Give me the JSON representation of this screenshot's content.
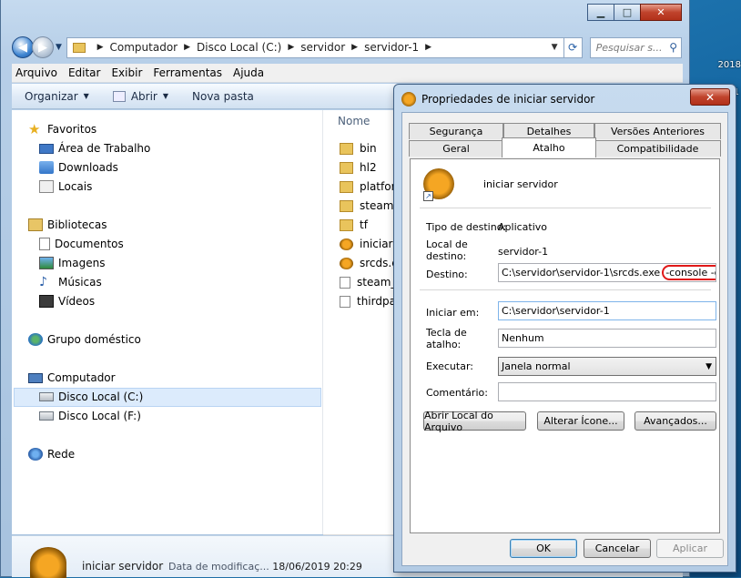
{
  "desktop": {
    "corner_text_1": "2018",
    "corner_text_2": "1"
  },
  "explorer": {
    "caption": {
      "minimize": "▁",
      "maximize": "□",
      "close": "✕"
    },
    "address": {
      "crumbs": [
        "Computador",
        "Disco Local (C:)",
        "servidor",
        "servidor-1"
      ]
    },
    "search_placeholder": "Pesquisar s...",
    "menu": [
      "Arquivo",
      "Editar",
      "Exibir",
      "Ferramentas",
      "Ajuda"
    ],
    "toolbar": {
      "organize": "Organizar",
      "open": "Abrir",
      "new_folder": "Nova pasta"
    },
    "nav": {
      "favorites": "Favoritos",
      "desktop": "Área de Trabalho",
      "downloads": "Downloads",
      "places": "Locais",
      "libraries": "Bibliotecas",
      "documents": "Documentos",
      "images": "Imagens",
      "music": "Músicas",
      "videos": "Vídeos",
      "homegroup": "Grupo doméstico",
      "computer": "Computador",
      "disk_c": "Disco Local (C:)",
      "disk_f": "Disco Local (F:)",
      "network": "Rede"
    },
    "files": {
      "column_name": "Nome",
      "items": [
        "bin",
        "hl2",
        "platform",
        "steamapps",
        "tf",
        "iniciar servidor",
        "srcds.exe",
        "steam_appid.txt",
        "thirdparty"
      ]
    },
    "details": {
      "name": "iniciar servidor",
      "modified_label": "Data de modificaç...",
      "modified_value": "18/06/2019 20:29"
    }
  },
  "dialog": {
    "title": "Propriedades de iniciar servidor",
    "close": "✕",
    "tabs_back": [
      "Segurança",
      "Detalhes",
      "Versões Anteriores"
    ],
    "tabs_front": [
      "Geral",
      "Atalho",
      "Compatibilidade"
    ],
    "active_tab": "Atalho",
    "shortcut_name": "iniciar servidor",
    "target_type_label": "Tipo de destino:",
    "target_type_value": "Aplicativo",
    "target_location_label": "Local de destino:",
    "target_location_value": "servidor-1",
    "target_label": "Destino:",
    "target_value": "C:\\servidor\\servidor-1\\srcds.exe",
    "target_args": "-console -game t",
    "start_in_label": "Iniciar em:",
    "start_in_value": "C:\\servidor\\servidor-1",
    "hotkey_label": "Tecla de atalho:",
    "hotkey_value": "Nenhum",
    "run_label": "Executar:",
    "run_value": "Janela normal",
    "comment_label": "Comentário:",
    "comment_value": "",
    "buttons": {
      "open_location": "Abrir Local do Arquivo",
      "change_icon": "Alterar Ícone...",
      "advanced": "Avançados...",
      "ok": "OK",
      "cancel": "Cancelar",
      "apply": "Aplicar"
    }
  }
}
